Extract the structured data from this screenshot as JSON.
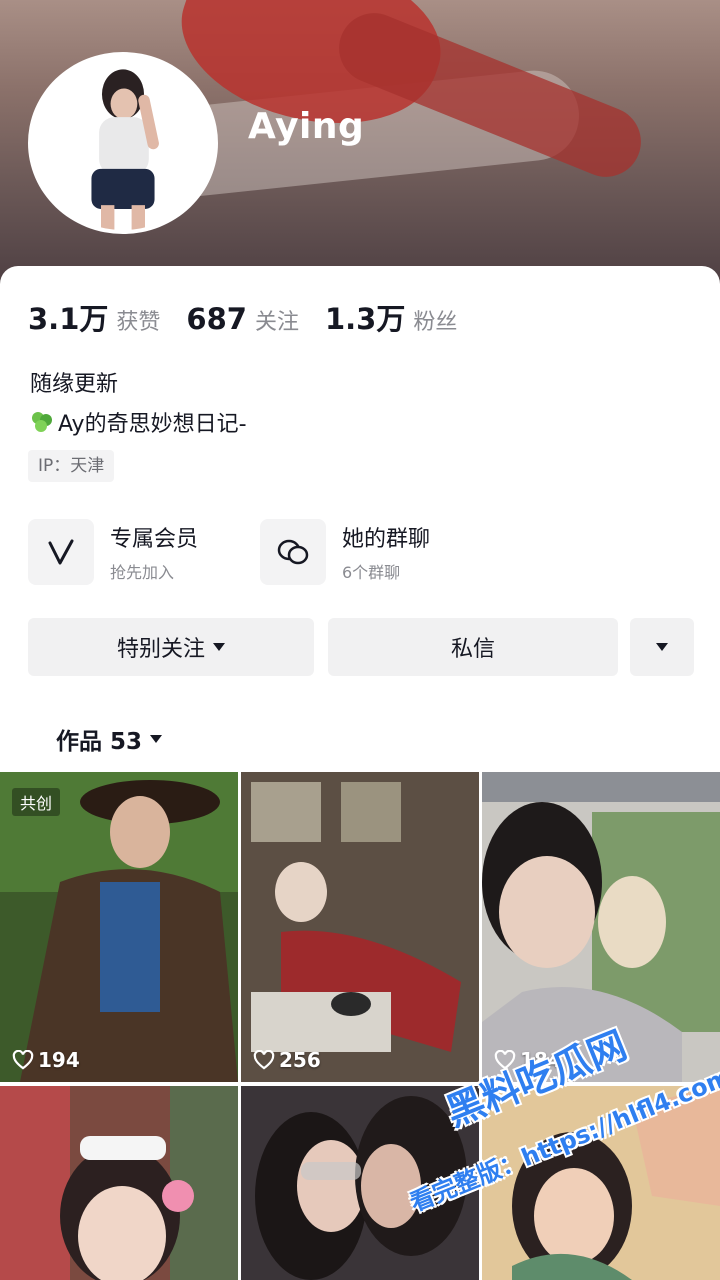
{
  "profile": {
    "username": "Aying"
  },
  "stats": [
    {
      "num": "3.1万",
      "label": "获赞"
    },
    {
      "num": "687",
      "label": "关注"
    },
    {
      "num": "1.3万",
      "label": "粉丝"
    }
  ],
  "bio": {
    "line1": "随缘更新",
    "line2": "Ay的奇思妙想日记-",
    "ip": "IP：天津"
  },
  "features": [
    {
      "title": "专属会员",
      "subtitle": "抢先加入",
      "icon": "v-member-icon"
    },
    {
      "title": "她的群聊",
      "subtitle": "6个群聊",
      "icon": "group-chat-icon"
    }
  ],
  "actions": {
    "special_follow": "特别关注",
    "message": "私信"
  },
  "works": {
    "label": "作品 53"
  },
  "grid": [
    {
      "likes": "194",
      "badge": "共创"
    },
    {
      "likes": "256"
    },
    {
      "likes": "184"
    },
    {},
    {},
    {}
  ],
  "watermark": {
    "line1": "黑料吃瓜网",
    "line2": "看完整版：https://hlfl4.com"
  }
}
